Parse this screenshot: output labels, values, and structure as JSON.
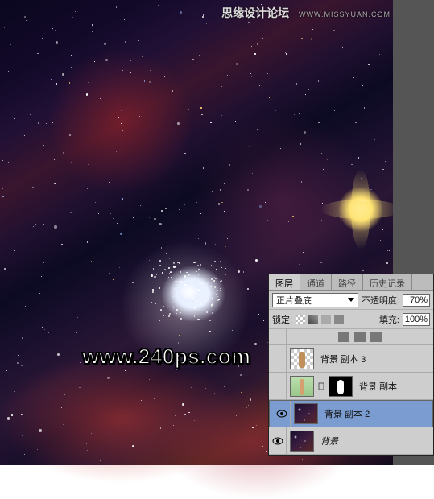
{
  "watermark1": {
    "text": "思缘设计论坛",
    "url": "WWW.MISSYUAN.COM"
  },
  "watermark2": "www.240ps.com",
  "panel": {
    "tabs": [
      "图层",
      "通道",
      "路径",
      "历史记录"
    ],
    "activeTab": 0,
    "blendMode": "正片叠底",
    "opacityLabel": "不透明度:",
    "opacityValue": "70%",
    "lockLabel": "锁定:",
    "fillLabel": "填充:",
    "fillValue": "100%",
    "layers": [
      {
        "visible": false,
        "name": "背景 副本 3",
        "thumb": "check",
        "mask": false,
        "italic": false
      },
      {
        "visible": false,
        "name": "背景 副本",
        "thumb": "fig",
        "mask": true,
        "italic": false
      },
      {
        "visible": true,
        "name": "背景 副本 2",
        "thumb": "neb",
        "mask": false,
        "italic": false,
        "selected": true
      },
      {
        "visible": true,
        "name": "背景",
        "thumb": "neb",
        "mask": false,
        "italic": true
      }
    ]
  }
}
